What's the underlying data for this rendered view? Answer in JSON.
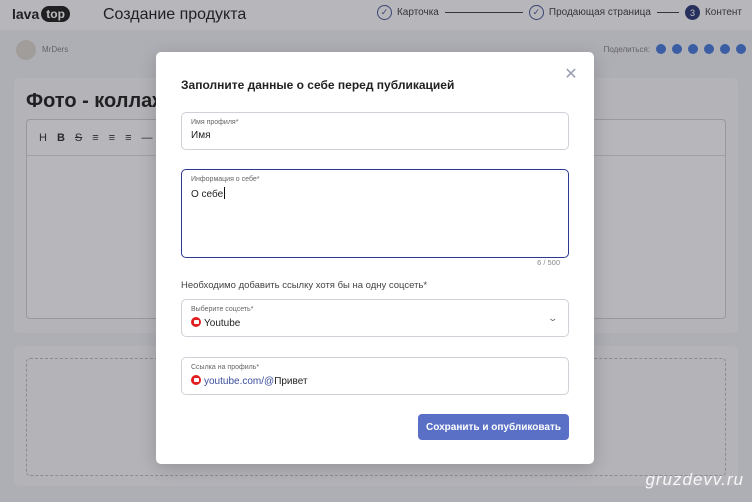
{
  "header": {
    "logo_left": "lava",
    "logo_right": "top",
    "title": "Создание продукта",
    "steps": [
      {
        "label": "Карточка",
        "state": "done"
      },
      {
        "label": "Продающая страница",
        "state": "done"
      },
      {
        "number": "3",
        "label": "Контент",
        "state": "current"
      }
    ]
  },
  "subheader": {
    "username": "MrDers",
    "share_label": "Поделиться:"
  },
  "background": {
    "card_title": "Фото - коллаж",
    "toolbar": [
      "H",
      "B",
      "S",
      "≡",
      "≡",
      "≡",
      "—"
    ]
  },
  "modal": {
    "title": "Заполните данные о себе перед публикацией",
    "close_icon": "close-icon",
    "name_field": {
      "label": "Имя профиля*",
      "value": "Имя"
    },
    "about_field": {
      "label": "Информация о себе*",
      "value": "О себе",
      "counter": "6 / 500"
    },
    "social_hint": "Необходимо добавить ссылку хотя бы на одну соцсеть*",
    "social_select": {
      "label": "Выберите соцсеть*",
      "value": "Youtube",
      "icon": "youtube-icon"
    },
    "link_field": {
      "label": "Ссылка на профиль*",
      "prefix": "youtube.com/@",
      "value": "Привет",
      "icon": "youtube-icon"
    },
    "submit_label": "Сохранить и опубликовать"
  },
  "watermark": "gruzdevv.ru",
  "colors": {
    "primary_button": "#5a70c6",
    "focus_border": "#2b3a8c",
    "youtube_red": "#e02020",
    "step_current": "#1d2a6b"
  }
}
